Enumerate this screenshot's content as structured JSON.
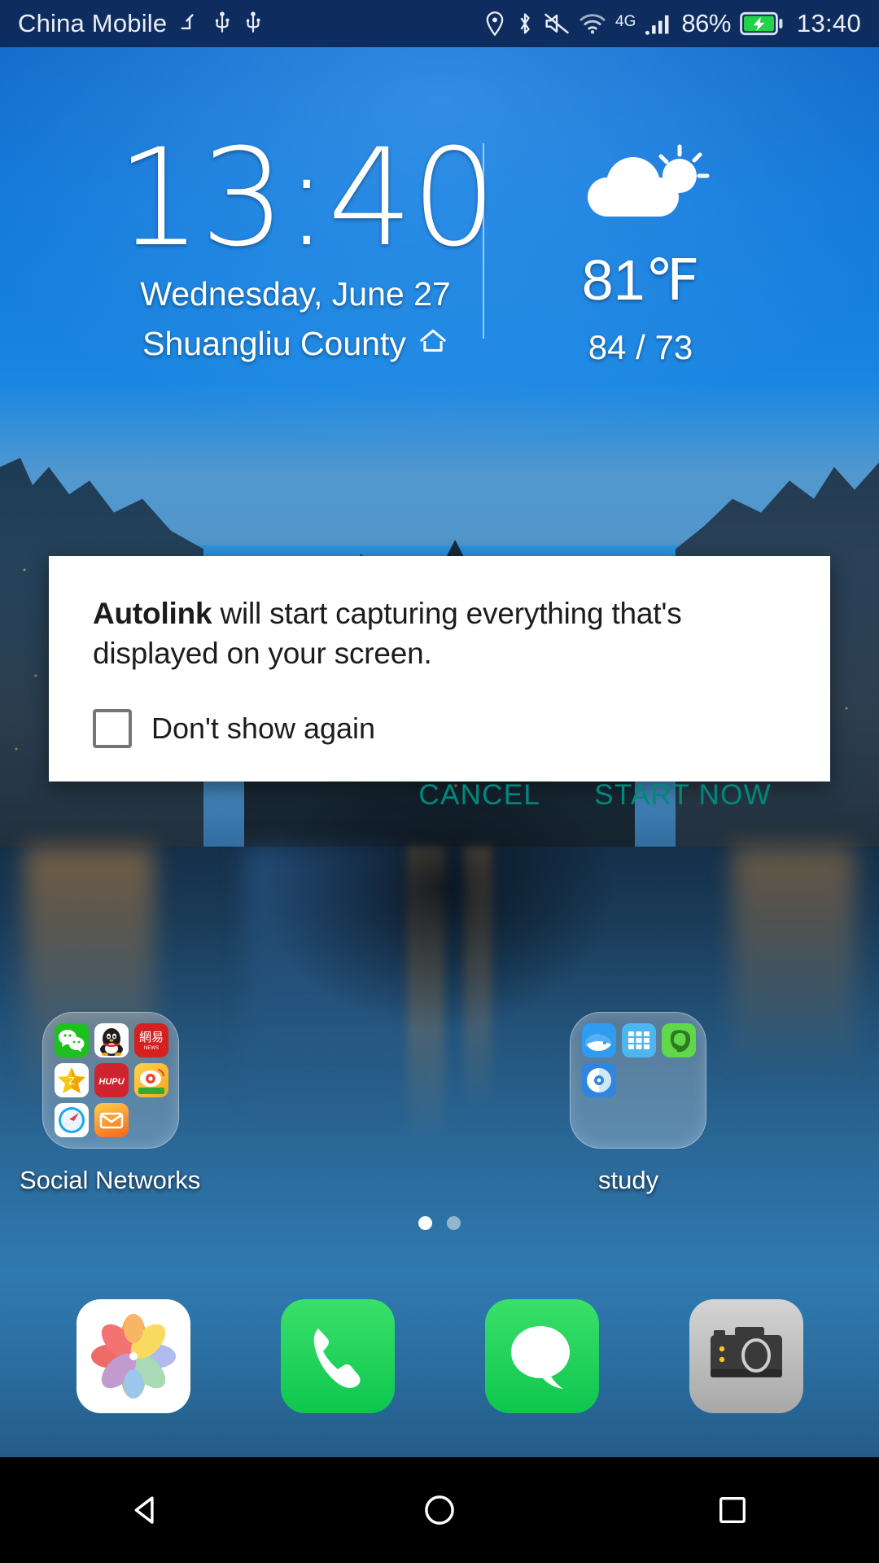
{
  "statusbar": {
    "carrier": "China Mobile",
    "icons_left": [
      "signal-roaming-icon",
      "usb-icon",
      "usb-icon"
    ],
    "icons_right": [
      "location-icon",
      "bluetooth-icon",
      "mute-icon",
      "wifi-icon",
      "network-4g-icon",
      "signal-bars-icon"
    ],
    "battery_percent": "86%",
    "battery_state": "charging",
    "clock": "13:40",
    "background_color": "#0e2c5e",
    "text_color": "#e9eef6"
  },
  "widget": {
    "clock": "13:40",
    "date": "Wednesday, June 27",
    "location": "Shuangliu County",
    "location_icon": "home-icon",
    "weather_icon": "partly-cloudy-icon",
    "temperature": "81℉",
    "high_low": "84 / 73"
  },
  "dialog": {
    "app_name": "Autolink",
    "message_rest": " will start capturing everything that's displayed on your screen.",
    "checkbox_label": "Don't show again",
    "checkbox_checked": false,
    "cancel_label": "CANCEL",
    "start_label": "START NOW",
    "accent_color": "#00897b",
    "background_color": "#ffffff"
  },
  "folders": [
    {
      "name": "Social Networks",
      "label": "Social Networks",
      "apps": [
        {
          "name": "wechat",
          "icon": "wechat-icon"
        },
        {
          "name": "qq",
          "icon": "qq-penguin-icon"
        },
        {
          "name": "netease",
          "icon": "netease-icon"
        },
        {
          "name": "qzone",
          "icon": "qzone-star-icon"
        },
        {
          "name": "hupu",
          "icon": "hupu-icon"
        },
        {
          "name": "weibo",
          "icon": "weibo-icon"
        },
        {
          "name": "safari",
          "icon": "safari-compass-icon"
        },
        {
          "name": "mail",
          "icon": "mail-envelope-icon"
        }
      ]
    },
    {
      "name": "study",
      "label": "study",
      "apps": [
        {
          "name": "app-whale",
          "icon": "whale-icon"
        },
        {
          "name": "app-dict",
          "icon": "dictionary-icon"
        },
        {
          "name": "evernote",
          "icon": "evernote-elephant-icon"
        },
        {
          "name": "app-disc",
          "icon": "disc-icon"
        }
      ]
    }
  ],
  "page_dots": {
    "count": 2,
    "active_index": 0
  },
  "dock": [
    {
      "name": "photos",
      "icon": "photos-flower-icon",
      "label": "Photos"
    },
    {
      "name": "phone",
      "icon": "phone-handset-icon",
      "label": "Phone"
    },
    {
      "name": "messages",
      "icon": "message-bubble-icon",
      "label": "Messages"
    },
    {
      "name": "camera",
      "icon": "camera-icon",
      "label": "Camera"
    }
  ],
  "navbar": {
    "back": "back-triangle-icon",
    "home": "home-circle-icon",
    "recents": "recents-square-icon",
    "background_color": "#000000"
  }
}
